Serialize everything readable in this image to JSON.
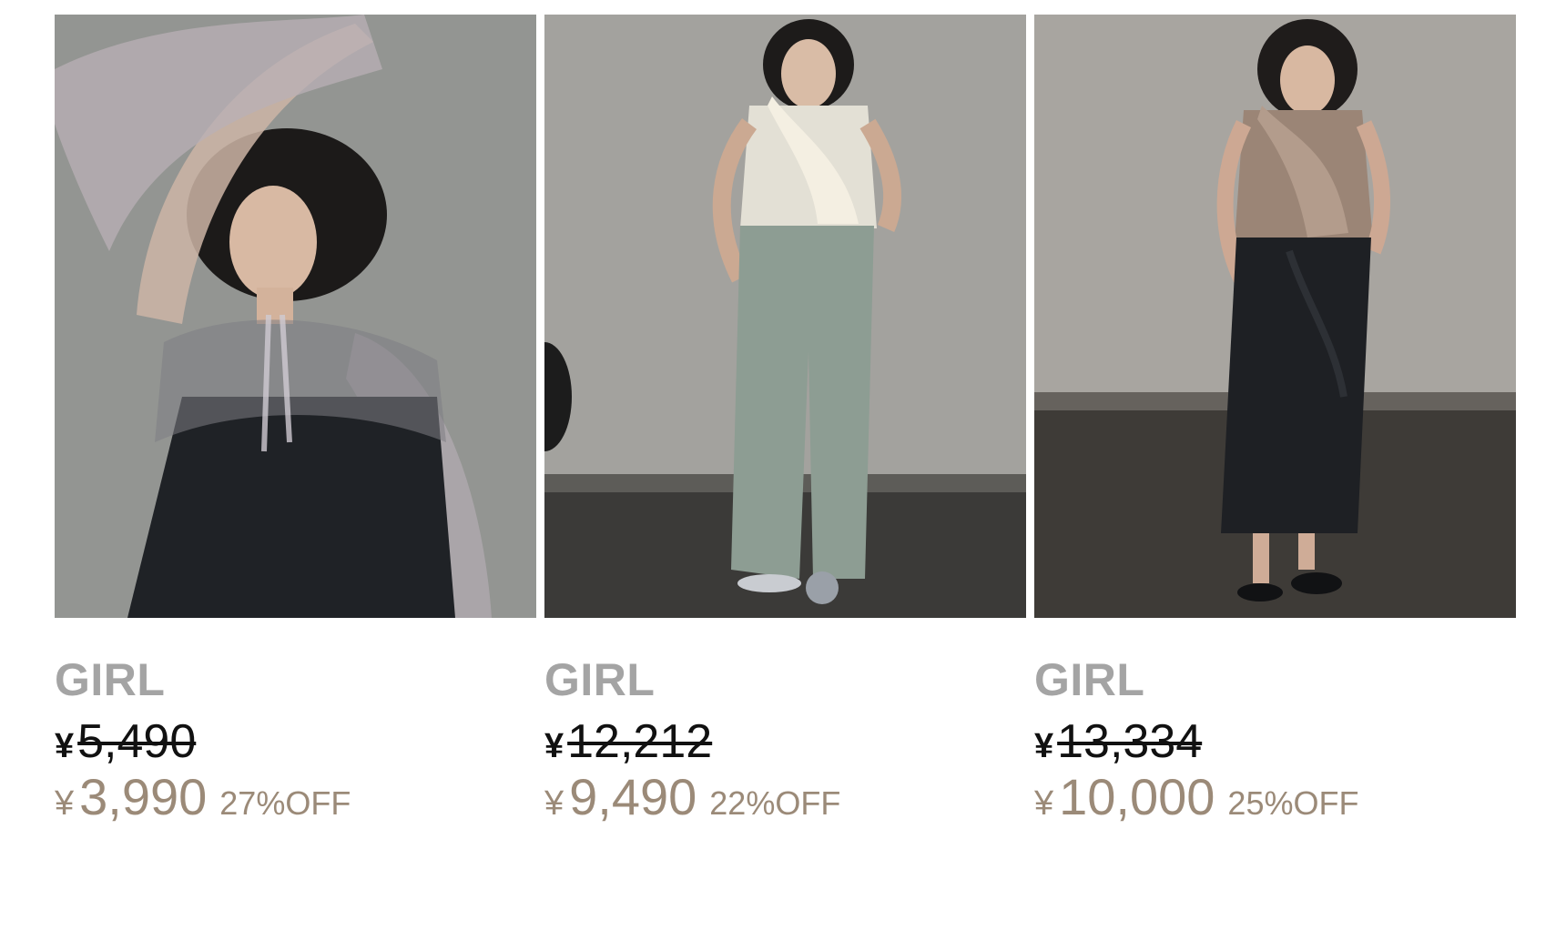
{
  "products": [
    {
      "image_alt": "product-photo-tulle-bolero-camisole",
      "brand": "GIRL",
      "currency": "¥",
      "original_price": "5,490",
      "sale_price": "3,990",
      "discount": "27%OFF"
    },
    {
      "image_alt": "product-photo-ruffle-top-jumpsuit",
      "brand": "GIRL",
      "currency": "¥",
      "original_price": "12,212",
      "sale_price": "9,490",
      "discount": "22%OFF"
    },
    {
      "image_alt": "product-photo-ruffle-top-skirt-set",
      "brand": "GIRL",
      "currency": "¥",
      "original_price": "13,334",
      "sale_price": "10,000",
      "discount": "25%OFF"
    }
  ],
  "colors": {
    "brand_text": "#a4a4a4",
    "original_price": "#111111",
    "sale_price": "#9b8a78"
  }
}
